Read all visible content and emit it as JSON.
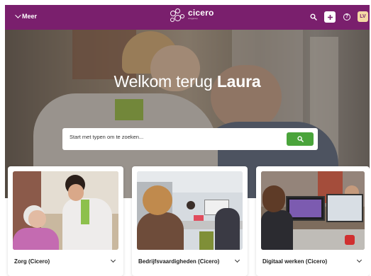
{
  "topbar": {
    "menu_label": "Meer",
    "logo_name": "cicero",
    "logo_sub": "zorggroep",
    "avatar_initials": "LV",
    "icons": [
      "search-icon",
      "plus-icon",
      "help-icon"
    ],
    "brand_color": "#7a1f6d",
    "accent_color": "#4aa43b"
  },
  "hero": {
    "greeting": "Welkom terug",
    "user_name": "Laura",
    "search_placeholder": "Start met typen om te zoeken..."
  },
  "cards": [
    {
      "title": "Zorg (Cicero)"
    },
    {
      "title": "Bedrijfsvaardigheden (Cicero)"
    },
    {
      "title": "Digitaal werken (Cicero)"
    }
  ]
}
